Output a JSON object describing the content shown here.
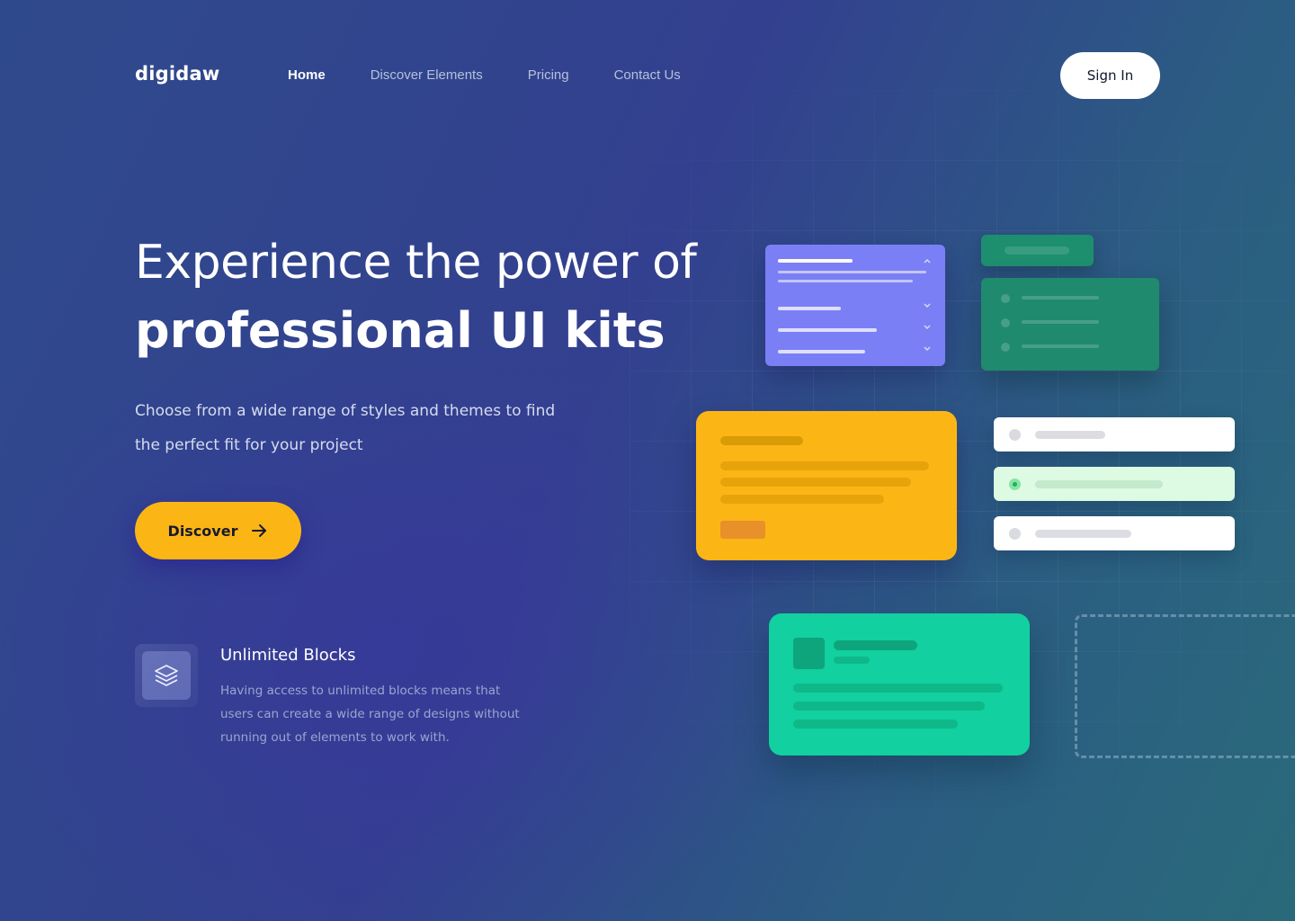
{
  "brand": {
    "name": "digidaw"
  },
  "nav": {
    "items": [
      {
        "label": "Home",
        "active": true
      },
      {
        "label": "Discover Elements",
        "active": false
      },
      {
        "label": "Pricing",
        "active": false
      },
      {
        "label": "Contact Us",
        "active": false
      }
    ],
    "signin_label": "Sign In"
  },
  "hero": {
    "title_light": "Experience the power of",
    "title_bold": "professional UI kits",
    "subtitle": "Choose from a wide range of styles and themes to find the perfect fit for your project",
    "cta_label": "Discover",
    "cta_icon": "arrow-right-icon"
  },
  "feature": {
    "icon": "layers-icon",
    "title": "Unlimited Blocks",
    "description": "Having access to unlimited blocks means that users can create a wide range of designs without running out of elements to work with."
  },
  "colors": {
    "accent_yellow": "#fbb616",
    "card_purple": "#7b7ff5",
    "card_green": "#1f8a6d",
    "card_teal": "#12d09f",
    "selected_row": "#ddfbe2"
  }
}
